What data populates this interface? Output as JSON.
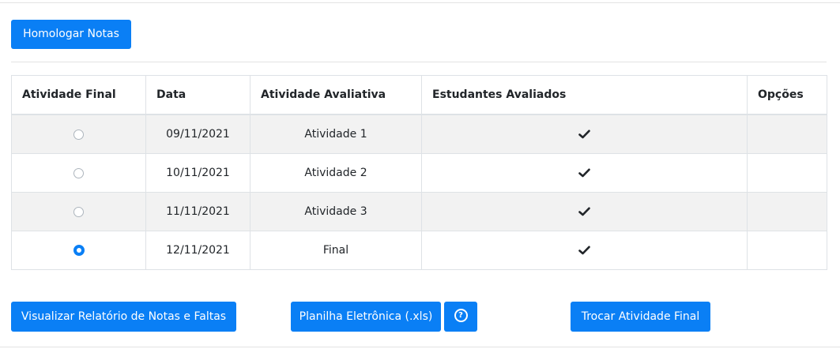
{
  "toolbar": {
    "homologar_label": "Homologar Notas"
  },
  "table": {
    "headers": [
      "Atividade Final",
      "Data",
      "Atividade Avaliativa",
      "Estudantes Avaliados",
      "Opções"
    ],
    "rows": [
      {
        "final_selected": false,
        "data": "09/11/2021",
        "atividade": "Atividade 1",
        "avaliados": "check-icon",
        "opcoes": ""
      },
      {
        "final_selected": false,
        "data": "10/11/2021",
        "atividade": "Atividade 2",
        "avaliados": "check-icon",
        "opcoes": ""
      },
      {
        "final_selected": false,
        "data": "11/11/2021",
        "atividade": "Atividade 3",
        "avaliados": "check-icon",
        "opcoes": ""
      },
      {
        "final_selected": true,
        "data": "12/11/2021",
        "atividade": "Final",
        "avaliados": "check-icon",
        "opcoes": ""
      }
    ]
  },
  "actions": {
    "relatorio_label": "Visualizar Relatório de Notas e Faltas",
    "planilha_label": "Planilha Eletrônica (.xls)",
    "help_icon": "question-circle-icon",
    "trocar_label": "Trocar Atividade Final"
  },
  "colors": {
    "primary": "#0a7ff5",
    "stripe": "#f2f2f2",
    "border": "#dee2e6"
  }
}
